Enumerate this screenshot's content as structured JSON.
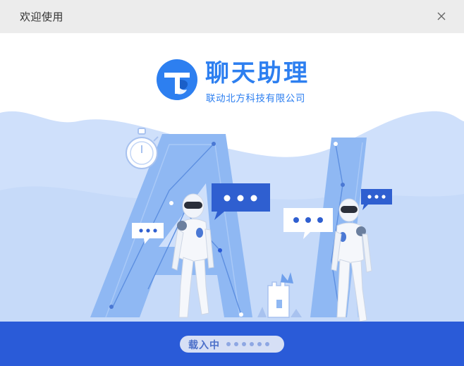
{
  "window": {
    "title": "欢迎使用",
    "close_icon": "close-icon"
  },
  "brand": {
    "app_name": "聊天助理",
    "company": "联动北方科技有限公司",
    "logo_icon": "chat-assistant-logo-icon"
  },
  "illustration": {
    "icons": [
      "stopwatch-icon",
      "robot-icon",
      "chat-bubble-icon",
      "castle-icon"
    ]
  },
  "loading": {
    "label": "载入中",
    "dot_count": 6
  },
  "colors": {
    "brand_blue": "#2d7ff0",
    "footer_blue": "#2a5bd8",
    "bubble_blue": "#2f5fd0",
    "sky_light": "#c9dcfb"
  }
}
